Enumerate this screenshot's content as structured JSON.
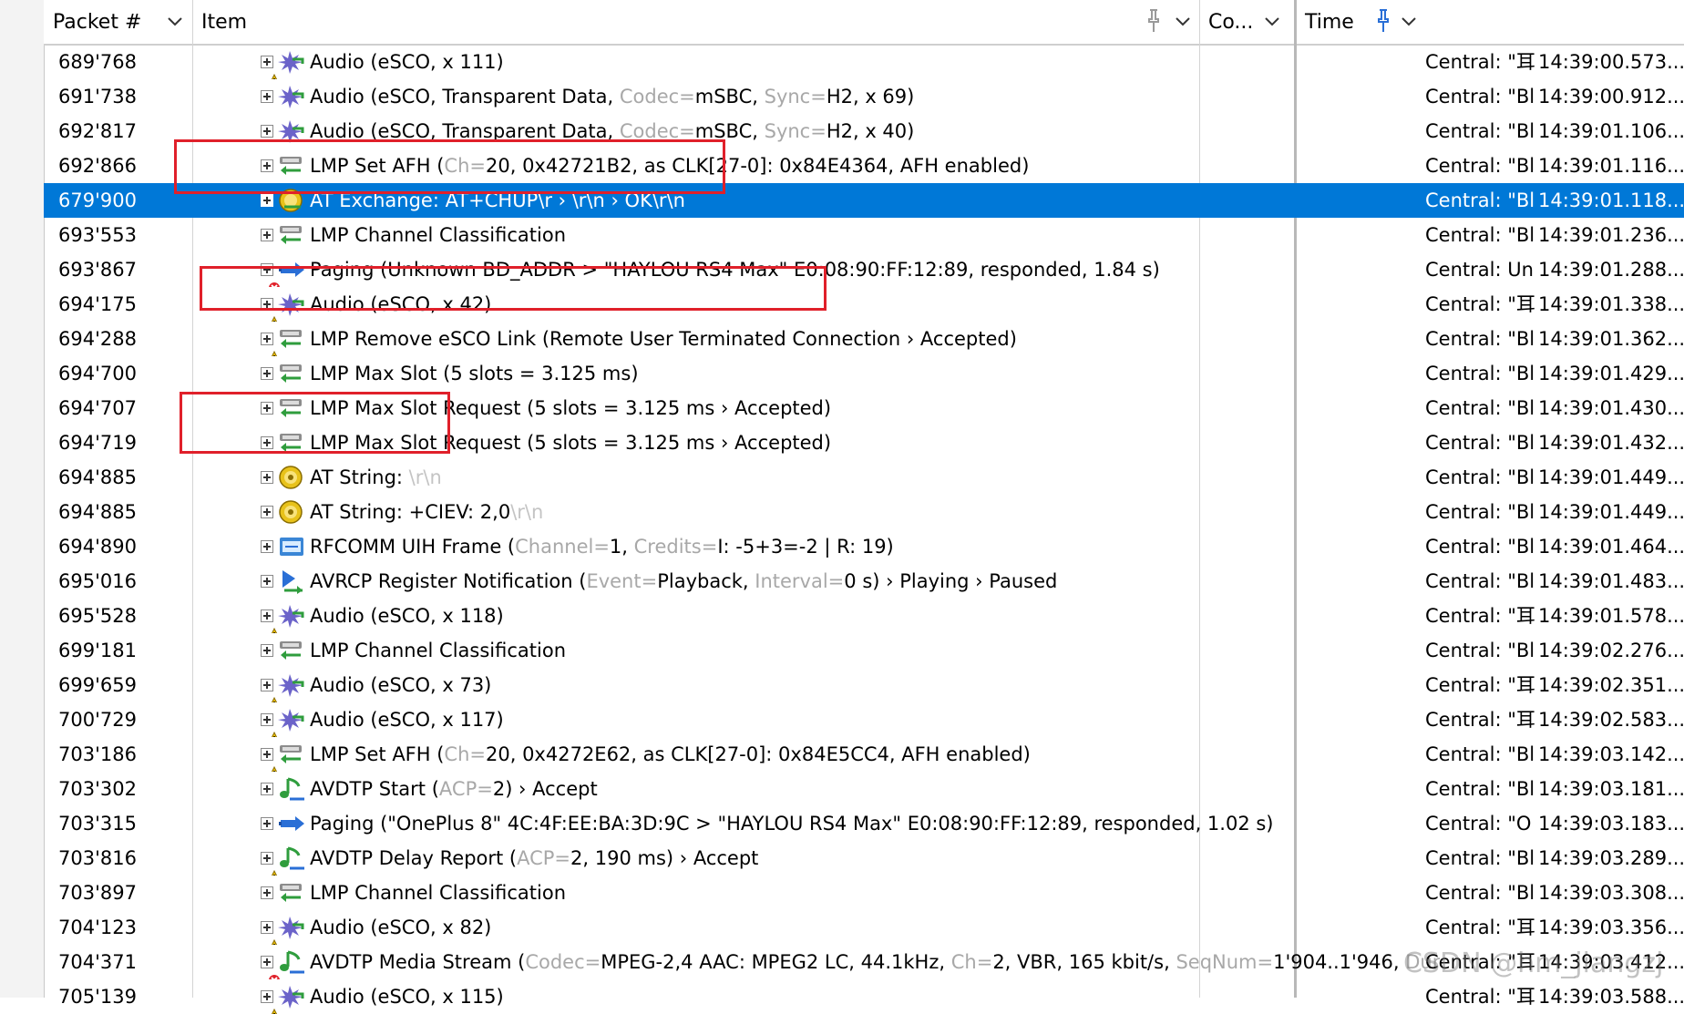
{
  "columns": {
    "packet": "Packet #",
    "item": "Item",
    "co": "Co...",
    "time": "Time"
  },
  "watermark": "CSDN @hm_jiangzj",
  "rows": [
    {
      "pkt": "689'768",
      "icon": "audio-icon",
      "warn": true,
      "segs": [
        [
          "t",
          "Audio (eSCO, x 111)"
        ]
      ],
      "co": "Central: \"耳",
      "time": "14:39:00.573..."
    },
    {
      "pkt": "691'738",
      "icon": "audio-icon",
      "warn": false,
      "segs": [
        [
          "t",
          "Audio (eSCO, Transparent Data, "
        ],
        [
          "k",
          "Codec="
        ],
        [
          "t",
          "mSBC, "
        ],
        [
          "k",
          "Sync="
        ],
        [
          "t",
          "H2, x 69)"
        ]
      ],
      "co": "Central: \"Bl",
      "time": "14:39:00.912..."
    },
    {
      "pkt": "692'817",
      "icon": "audio-icon",
      "warn": false,
      "segs": [
        [
          "t",
          "Audio (eSCO, Transparent Data, "
        ],
        [
          "k",
          "Codec="
        ],
        [
          "t",
          "mSBC, "
        ],
        [
          "k",
          "Sync="
        ],
        [
          "t",
          "H2, x 40)"
        ]
      ],
      "co": "Central: \"Bl",
      "time": "14:39:01.106..."
    },
    {
      "pkt": "692'866",
      "icon": "lmp-icon",
      "warn": false,
      "segs": [
        [
          "t",
          "LMP Set AFH ("
        ],
        [
          "k",
          "Ch="
        ],
        [
          "t",
          "20, 0x42721B2, as CLK[27-0]: 0x84E4364, AFH enabled)"
        ]
      ],
      "co": "Central: \"Bl",
      "time": "14:39:01.116..."
    },
    {
      "pkt": "679'900",
      "icon": "at-exchange-icon",
      "warn": false,
      "sel": true,
      "segs": [
        [
          "t",
          "AT Exchange: AT+CHUP\\r › \\r\\n › OK\\r\\n"
        ]
      ],
      "co": "Central: \"Bl",
      "time": "14:39:01.118..."
    },
    {
      "pkt": "693'553",
      "icon": "lmp-icon",
      "warn": false,
      "segs": [
        [
          "t",
          "LMP Channel Classification"
        ]
      ],
      "co": "Central: \"Bl",
      "time": "14:39:01.236..."
    },
    {
      "pkt": "693'867",
      "icon": "paging-icon",
      "warn": true,
      "warnType": "error",
      "segs": [
        [
          "t",
          "Paging (Unknown BD_ADDR > \"HAYLOU RS4 Max\" E0:08:90:FF:12:89, responded, 1.84 s)"
        ]
      ],
      "co": "Central: Un",
      "time": "14:39:01.288..."
    },
    {
      "pkt": "694'175",
      "icon": "audio-icon",
      "warn": true,
      "segs": [
        [
          "t",
          "Audio (eSCO, x 42)"
        ]
      ],
      "co": "Central: \"耳",
      "time": "14:39:01.338..."
    },
    {
      "pkt": "694'288",
      "icon": "lmp-icon",
      "warn": true,
      "segs": [
        [
          "t",
          "LMP Remove eSCO Link (Remote User Terminated Connection › Accepted)"
        ]
      ],
      "co": "Central: \"Bl",
      "time": "14:39:01.362..."
    },
    {
      "pkt": "694'700",
      "icon": "lmp-icon",
      "warn": false,
      "segs": [
        [
          "t",
          "LMP Max Slot (5 slots = 3.125 ms)"
        ]
      ],
      "co": "Central: \"Bl",
      "time": "14:39:01.429..."
    },
    {
      "pkt": "694'707",
      "icon": "lmp-icon",
      "warn": false,
      "segs": [
        [
          "t",
          "LMP Max Slot Request (5 slots = 3.125 ms › Accepted)"
        ]
      ],
      "co": "Central: \"Bl",
      "time": "14:39:01.430..."
    },
    {
      "pkt": "694'719",
      "icon": "lmp-icon",
      "warn": false,
      "segs": [
        [
          "t",
          "LMP Max Slot Request (5 slots = 3.125 ms › Accepted)"
        ]
      ],
      "co": "Central: \"Bl",
      "time": "14:39:01.432..."
    },
    {
      "pkt": "694'885",
      "icon": "at-string-icon",
      "warn": false,
      "segs": [
        [
          "t",
          "AT String: "
        ],
        [
          "d",
          "\\r\\n"
        ]
      ],
      "co": "Central: \"Bl",
      "time": "14:39:01.449..."
    },
    {
      "pkt": "694'885",
      "icon": "at-string-icon",
      "warn": false,
      "segs": [
        [
          "t",
          "AT String: +CIEV: 2,0"
        ],
        [
          "d",
          "\\r\\n"
        ]
      ],
      "co": "Central: \"Bl",
      "time": "14:39:01.449..."
    },
    {
      "pkt": "694'890",
      "icon": "rfcomm-icon",
      "warn": false,
      "segs": [
        [
          "t",
          "RFCOMM UIH Frame ("
        ],
        [
          "k",
          "Channel="
        ],
        [
          "t",
          "1, "
        ],
        [
          "k",
          "Credits="
        ],
        [
          "t",
          "I: -5+3=-2 | R: 19)"
        ]
      ],
      "co": "Central: \"Bl",
      "time": "14:39:01.464..."
    },
    {
      "pkt": "695'016",
      "icon": "avrcp-icon",
      "warn": false,
      "segs": [
        [
          "t",
          "AVRCP Register Notification ("
        ],
        [
          "k",
          "Event="
        ],
        [
          "t",
          "Playback, "
        ],
        [
          "k",
          "Interval="
        ],
        [
          "t",
          "0 s) › Playing › Paused"
        ]
      ],
      "co": "Central: \"Bl",
      "time": "14:39:01.483..."
    },
    {
      "pkt": "695'528",
      "icon": "audio-icon",
      "warn": true,
      "segs": [
        [
          "t",
          "Audio (eSCO, x 118)"
        ]
      ],
      "co": "Central: \"耳",
      "time": "14:39:01.578..."
    },
    {
      "pkt": "699'181",
      "icon": "lmp-icon",
      "warn": false,
      "segs": [
        [
          "t",
          "LMP Channel Classification"
        ]
      ],
      "co": "Central: \"Bl",
      "time": "14:39:02.276..."
    },
    {
      "pkt": "699'659",
      "icon": "audio-icon",
      "warn": true,
      "segs": [
        [
          "t",
          "Audio (eSCO, x 73)"
        ]
      ],
      "co": "Central: \"耳",
      "time": "14:39:02.351..."
    },
    {
      "pkt": "700'729",
      "icon": "audio-icon",
      "warn": true,
      "segs": [
        [
          "t",
          "Audio (eSCO, x 117)"
        ]
      ],
      "co": "Central: \"耳",
      "time": "14:39:02.583..."
    },
    {
      "pkt": "703'186",
      "icon": "lmp-icon",
      "warn": true,
      "segs": [
        [
          "t",
          "LMP Set AFH ("
        ],
        [
          "k",
          "Ch="
        ],
        [
          "t",
          "20, 0x4272E62, as CLK[27-0]: 0x84E5CC4, AFH enabled)"
        ]
      ],
      "co": "Central: \"Bl",
      "time": "14:39:03.142..."
    },
    {
      "pkt": "703'302",
      "icon": "avdtp-icon",
      "warn": false,
      "segs": [
        [
          "t",
          "AVDTP Start ("
        ],
        [
          "k",
          "ACP="
        ],
        [
          "t",
          "2) › Accept"
        ]
      ],
      "co": "Central: \"Bl",
      "time": "14:39:03.181..."
    },
    {
      "pkt": "703'315",
      "icon": "paging-icon",
      "warn": false,
      "segs": [
        [
          "t",
          "Paging (\"OnePlus 8\" 4C:4F:EE:BA:3D:9C > \"HAYLOU RS4 Max\" E0:08:90:FF:12:89, responded, 1.02 s)"
        ]
      ],
      "co": "Central: \"O",
      "time": "14:39:03.183..."
    },
    {
      "pkt": "703'816",
      "icon": "avdtp-icon",
      "warn": true,
      "segs": [
        [
          "t",
          "AVDTP Delay Report ("
        ],
        [
          "k",
          "ACP="
        ],
        [
          "t",
          "2, 190 ms) › Accept"
        ]
      ],
      "co": "Central: \"Bl",
      "time": "14:39:03.289..."
    },
    {
      "pkt": "703'897",
      "icon": "lmp-icon",
      "warn": false,
      "segs": [
        [
          "t",
          "LMP Channel Classification"
        ]
      ],
      "co": "Central: \"Bl",
      "time": "14:39:03.308..."
    },
    {
      "pkt": "704'123",
      "icon": "audio-icon",
      "warn": true,
      "segs": [
        [
          "t",
          "Audio (eSCO, x 82)"
        ]
      ],
      "co": "Central: \"耳",
      "time": "14:39:03.356..."
    },
    {
      "pkt": "704'371",
      "icon": "avdtp-icon",
      "warn": true,
      "warnType": "error",
      "segs": [
        [
          "t",
          "AVDTP Media Stream ("
        ],
        [
          "k",
          "Codec="
        ],
        [
          "t",
          "MPEG-2,4 AAC: MPEG2 LC, 44.1kHz, "
        ],
        [
          "k",
          "Ch="
        ],
        [
          "t",
          "2, VBR, 165 kbit/s, "
        ],
        [
          "k",
          "SeqNum="
        ],
        [
          "t",
          "1'904..1'946, "
        ],
        [
          "k",
          "Duration="
        ]
      ],
      "co": "Central: \"耳",
      "time": "14:39:03.412..."
    },
    {
      "pkt": "705'139",
      "icon": "audio-icon",
      "warn": true,
      "segs": [
        [
          "t",
          "Audio (eSCO, x 115)"
        ]
      ],
      "co": "Central: \"耳",
      "time": "14:39:03.588..."
    }
  ]
}
